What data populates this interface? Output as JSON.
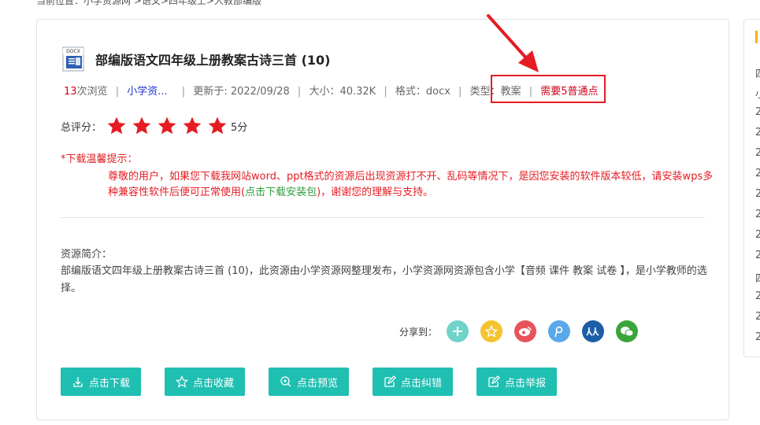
{
  "breadcrumb": "当前位置：小学资源网 >语文>四年级上>人教部编版",
  "doc": {
    "icon_label": "DOCX",
    "title": "部编版语文四年级上册教案古诗三首 (10)"
  },
  "meta": {
    "views": "13",
    "views_suffix": "次浏览",
    "source": "小学资...",
    "updated": "更新于: 2022/09/28",
    "size": "大小：40.32K",
    "format": "格式：docx",
    "type": "类型：教案",
    "points": "需要5普通点",
    "sep": "|"
  },
  "rating": {
    "label": "总评分：",
    "stars": 5,
    "score": "5分",
    "star_color": "#e51c23"
  },
  "notice": {
    "title": "*下载温馨提示：",
    "body_before": "尊敬的用户，如果您下载我网站word、ppt格式的资源后出现资源打不开、乱码等情况下，是因您安装的软件版本较低，请安装wps多种兼容性软件后便可正常使用(",
    "link": "点击下载安装包",
    "body_after": ")，谢谢您的理解与支持。"
  },
  "intro": {
    "label": "资源简介：",
    "text": "部编版语文四年级上册教案古诗三首 (10)，此资源由小学资源网整理发布，小学资源网资源包含小学【音频 课件 教案 试卷 】，是小学教师的选择。"
  },
  "share": {
    "label": "分享到：",
    "icons": [
      {
        "name": "plus-share-icon",
        "color": "#6fd3c8",
        "glyph": "+"
      },
      {
        "name": "qzone-icon",
        "color": "#f4c430",
        "glyph": "★"
      },
      {
        "name": "weibo-icon",
        "color": "#e8535b",
        "glyph": "◉"
      },
      {
        "name": "tencent-weibo-icon",
        "color": "#5aa8ea",
        "glyph": "P"
      },
      {
        "name": "renren-icon",
        "color": "#1d5ea8",
        "glyph": "从"
      },
      {
        "name": "wechat-icon",
        "color": "#3aa53a",
        "glyph": "●"
      }
    ]
  },
  "actions": {
    "download": "点击下载",
    "favorite": "点击收藏",
    "preview": "点击预览",
    "correct": "点击纠错",
    "report": "点击举报"
  },
  "right_panel": {
    "lines": [
      "四",
      "小",
      "2",
      "2",
      "2",
      "2",
      "2",
      "2",
      "2",
      "2",
      "四",
      "2",
      "2",
      "2"
    ]
  },
  "colors": {
    "accent": "#1fbfb2",
    "alert": "#e51c23",
    "link": "#2233cc"
  }
}
